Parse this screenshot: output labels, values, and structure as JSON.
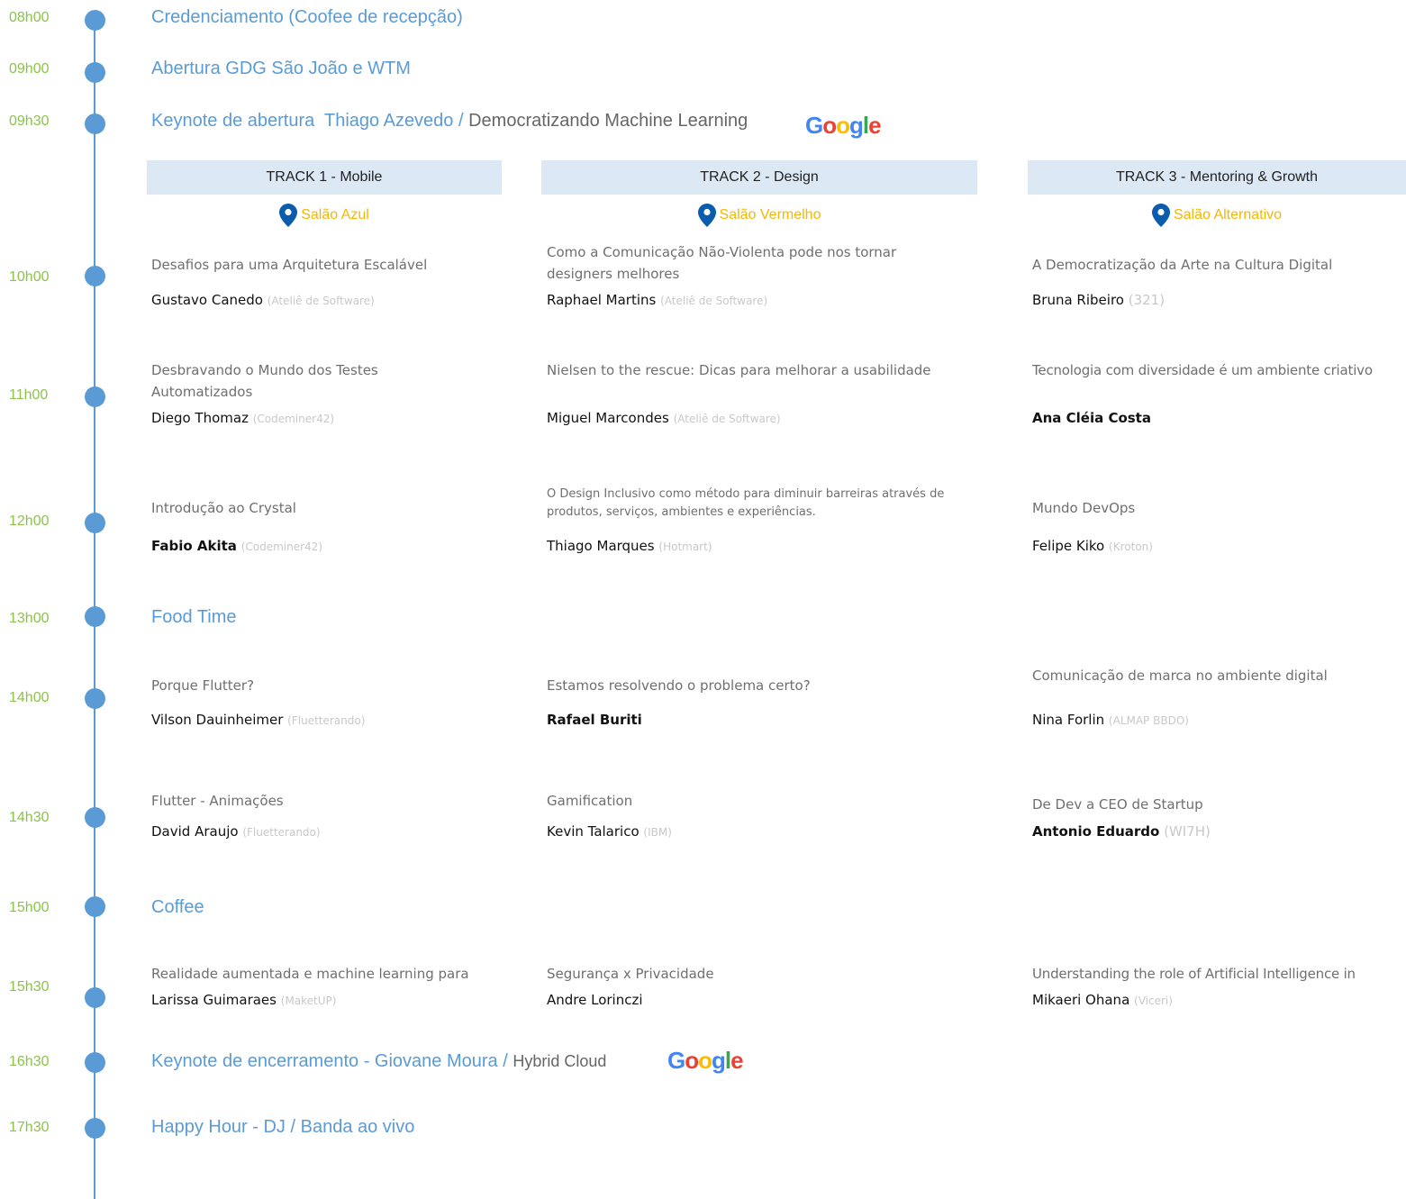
{
  "timeline": {
    "times": [
      "08h00",
      "09h00",
      "09h30",
      "10h00",
      "11h00",
      "12h00",
      "13h00",
      "14h00",
      "14h30",
      "15h00",
      "15h30",
      "16h30",
      "17h30"
    ]
  },
  "events": {
    "credenciamento": "Credenciamento (Coofee de recepção)",
    "abertura": "Abertura GDG São João e WTM",
    "keynote_open_label": "Keynote de abertura  Thiago Azevedo / ",
    "keynote_open_topic": "Democratizando Machine Learning",
    "food": "Food Time",
    "coffee": "Coffee",
    "keynote_close_label": "Keynote de encerramento - Giovane Moura / ",
    "keynote_close_topic": "Hybrid Cloud",
    "happy_hour": "Happy Hour - DJ / Banda ao vivo"
  },
  "google_logo": {
    "g1": "G",
    "o1": "o",
    "o2": "o",
    "g2": "g",
    "l": "l",
    "e": "e"
  },
  "tracks": [
    {
      "title": "TRACK 1 - Mobile",
      "room": "Salão Azul"
    },
    {
      "title": "TRACK 2 - Design",
      "room": "Salão Vermelho"
    },
    {
      "title": "TRACK 3 - Mentoring & Growth",
      "room": "Salão Alternativo"
    }
  ],
  "sessions": {
    "t1": [
      {
        "talk": "Desafios para uma Arquitetura Escalável",
        "speaker": "Gustavo Canedo",
        "company": "(Ateliê de Software)"
      },
      {
        "talk": "Desbravando o Mundo dos Testes Automatizados",
        "speaker": "Diego Thomaz",
        "company": "(Codeminer42)"
      },
      {
        "talk": "Introdução ao Crystal",
        "speaker": "Fabio Akita",
        "company": "(Codeminer42)"
      },
      {
        "talk": "Porque Flutter?",
        "speaker": "Vilson Dauinheimer",
        "company": "(Fluetterando)"
      },
      {
        "talk": "Flutter - Animações",
        "speaker": "David Araujo",
        "company": "(Fluetterando)"
      },
      {
        "talk": "Realidade aumentada e machine learning para",
        "speaker": "Larissa Guimaraes",
        "company": "(MaketUP)"
      }
    ],
    "t2": [
      {
        "talk": "Como a Comunicação Não-Violenta pode nos tornar designers melhores",
        "speaker": "Raphael Martins",
        "company": "(Ateliê de Software)"
      },
      {
        "talk": "Nielsen to the rescue: Dicas para melhorar a usabilidade",
        "speaker": "Miguel Marcondes",
        "company": "(Ateliê de Software)"
      },
      {
        "talk": "O Design Inclusivo como método para diminuir barreiras através de produtos, serviços, ambientes e experiências.",
        "speaker": "Thiago Marques",
        "company": "(Hotmart)"
      },
      {
        "talk": "Estamos resolvendo o problema certo?",
        "speaker": "Rafael Buriti",
        "company": ""
      },
      {
        "talk": "Gamification",
        "speaker": "Kevin Talarico",
        "company": "(IBM)"
      },
      {
        "talk": "Segurança x Privacidade",
        "speaker": "Andre Lorinczi",
        "company": ""
      }
    ],
    "t3": [
      {
        "talk": "A Democratização da Arte na Cultura Digital",
        "speaker": "Bruna Ribeiro",
        "company": "(321)"
      },
      {
        "talk": "Tecnologia com diversidade é um ambiente criativo",
        "speaker": "Ana Cléia Costa",
        "company": ""
      },
      {
        "talk": "Mundo DevOps",
        "speaker": "Felipe Kiko",
        "company": "(Kroton)"
      },
      {
        "talk": "Comunicação de marca no ambiente digital",
        "speaker": "Nina Forlin",
        "company": "(ALMAP BBDO)"
      },
      {
        "talk": "De Dev a CEO de Startup",
        "speaker": "Antonio Eduardo",
        "company": "(WI7H)"
      },
      {
        "talk": "Understanding the role of Artificial Intelligence in",
        "speaker": "Mikaeri Ohana",
        "company": "(Viceri)"
      }
    ]
  }
}
